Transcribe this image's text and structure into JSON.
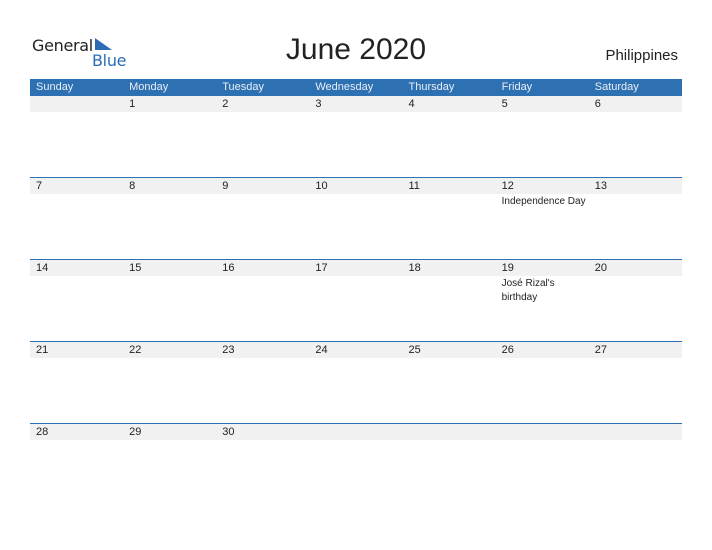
{
  "logo": {
    "general": "General",
    "blue": "Blue"
  },
  "title": "June 2020",
  "country": "Philippines",
  "colors": {
    "accent": "#2e71b3",
    "row_bg": "#f1f1f1"
  },
  "weekdays": [
    "Sunday",
    "Monday",
    "Tuesday",
    "Wednesday",
    "Thursday",
    "Friday",
    "Saturday"
  ],
  "weeks": [
    [
      {
        "day": ""
      },
      {
        "day": "1"
      },
      {
        "day": "2"
      },
      {
        "day": "3"
      },
      {
        "day": "4"
      },
      {
        "day": "5"
      },
      {
        "day": "6"
      }
    ],
    [
      {
        "day": "7"
      },
      {
        "day": "8"
      },
      {
        "day": "9"
      },
      {
        "day": "10"
      },
      {
        "day": "11"
      },
      {
        "day": "12",
        "event": "Independence Day"
      },
      {
        "day": "13"
      }
    ],
    [
      {
        "day": "14"
      },
      {
        "day": "15"
      },
      {
        "day": "16"
      },
      {
        "day": "17"
      },
      {
        "day": "18"
      },
      {
        "day": "19",
        "event": "José Rizal's birthday"
      },
      {
        "day": "20"
      }
    ],
    [
      {
        "day": "21"
      },
      {
        "day": "22"
      },
      {
        "day": "23"
      },
      {
        "day": "24"
      },
      {
        "day": "25"
      },
      {
        "day": "26"
      },
      {
        "day": "27"
      }
    ],
    [
      {
        "day": "28"
      },
      {
        "day": "29"
      },
      {
        "day": "30"
      },
      {
        "day": ""
      },
      {
        "day": ""
      },
      {
        "day": ""
      },
      {
        "day": ""
      }
    ]
  ]
}
